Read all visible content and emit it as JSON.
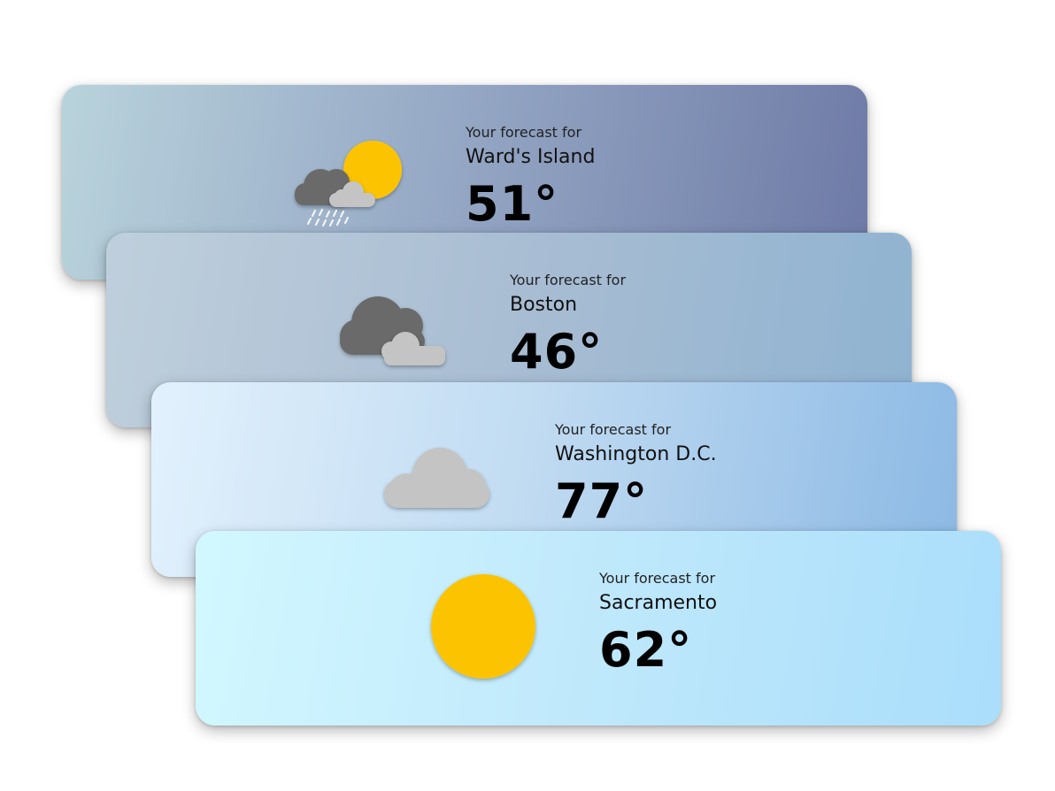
{
  "cards": [
    {
      "label": "Your forecast for",
      "city": "Ward's Island",
      "temperature": "51°",
      "icon": "sun-cloud-rain-icon"
    },
    {
      "label": "Your forecast for",
      "city": "Boston",
      "temperature": "46°",
      "icon": "cloudy-icon"
    },
    {
      "label": "Your forecast for",
      "city": "Washington D.C.",
      "temperature": "77°",
      "icon": "cloud-icon"
    },
    {
      "label": "Your forecast for",
      "city": "Sacramento",
      "temperature": "62°",
      "icon": "sun-icon"
    }
  ],
  "colors": {
    "sun": "#fcc400",
    "cloud_dark": "#6b6b6b",
    "cloud_light": "#c4c4c4",
    "rain": "#f2f2f2"
  }
}
